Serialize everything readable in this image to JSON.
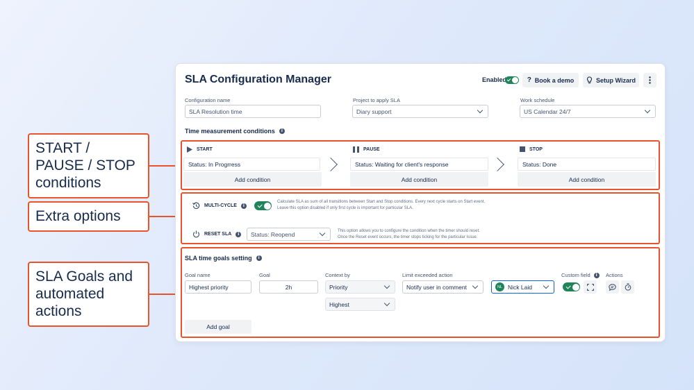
{
  "callouts": [
    {
      "text": "START / PAUSE / STOP conditions"
    },
    {
      "text": "Extra options"
    },
    {
      "text": "SLA Goals and automated actions"
    }
  ],
  "header": {
    "title": "SLA Configuration Manager",
    "enabled_label": "Enabled",
    "enabled": true,
    "book_demo": "Book a demo",
    "setup_wizard": "Setup Wizard"
  },
  "config": {
    "name_label": "Configuration name",
    "name_value": "SLA Resolution time",
    "project_label": "Project to apply SLA",
    "project_value": "Diary support",
    "schedule_label": "Work schedule",
    "schedule_value": "US Calendar 24/7"
  },
  "time_conditions": {
    "title": "Time measurement conditions",
    "phases": [
      {
        "label": "START",
        "condition": "Status: In Progrress",
        "add": "Add condition"
      },
      {
        "label": "PAUSE",
        "condition": "Status: Waiting for client's response",
        "add": "Add condition"
      },
      {
        "label": "STOP",
        "condition": "Status: Done",
        "add": "Add condition"
      }
    ]
  },
  "options": {
    "multicycle_label": "MULTI-CYCLE",
    "multicycle_enabled": true,
    "multicycle_desc_1": "Calculate SLA as sum of all transitions between Start and Stop conditions. Every next cycle starts on Start event.",
    "multicycle_desc_2": "Leave this option disabled if only first cycle is important for particular SLA.",
    "reset_label": "RESET SLA",
    "reset_value": "Status: Reopend",
    "reset_desc_1": "This option allows you to configure the condition when the timer should reset.",
    "reset_desc_2": "Once the Reset event occurs, the timer stops ticking for the particular Issue."
  },
  "goals": {
    "title": "SLA time goals setting",
    "col_goal_name": "Goal name",
    "col_goal": "Goal",
    "col_context": "Context by",
    "col_limit": "Limit exceeded action",
    "col_custom": "Custom field",
    "col_actions": "Actions",
    "row": {
      "goal_name": "Highest priority",
      "goal": "2h",
      "context": "Priority",
      "context_value": "Highest",
      "limit_action": "Notify user in comment",
      "user_initials": "NL",
      "user_name": "Nick Laid",
      "custom_enabled": true
    },
    "add_goal": "Add goal"
  },
  "colors": {
    "accent": "#e8532c",
    "toggle_on": "#1f845a",
    "selected_border": "#0c66e4"
  }
}
